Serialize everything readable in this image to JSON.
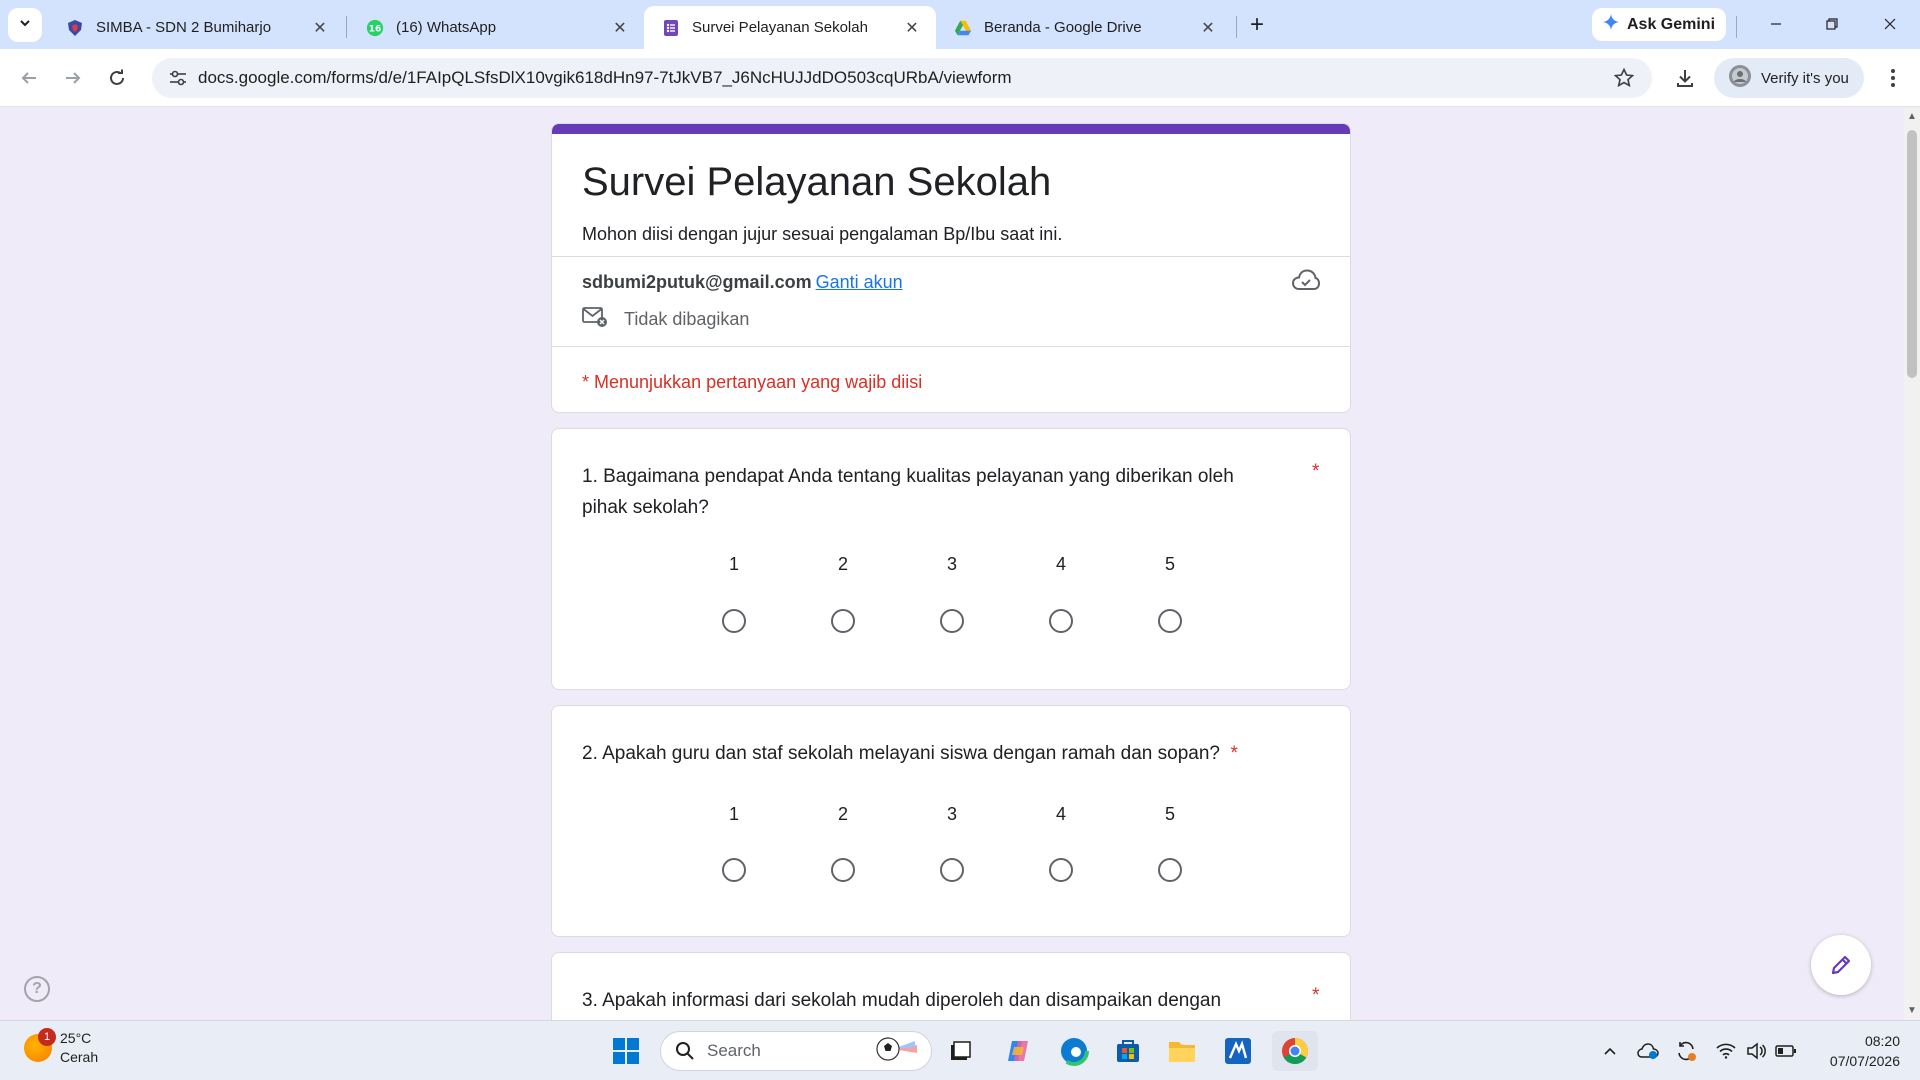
{
  "browser": {
    "tabs": [
      {
        "title": "SIMBA - SDN 2 Bumiharjo",
        "active": false
      },
      {
        "title": "(16) WhatsApp",
        "badge": "16",
        "active": false
      },
      {
        "title": "Survei Pelayanan Sekolah",
        "active": true
      },
      {
        "title": "Beranda - Google Drive",
        "active": false
      }
    ],
    "ask_gemini": "Ask Gemini",
    "url": "docs.google.com/forms/d/e/1FAIpQLSfsDlX10vgik618dHn97-7tJkVB7_J6NcHUJJdDO503cqURbA/viewform",
    "verify_label": "Verify it's you"
  },
  "form": {
    "title": "Survei Pelayanan Sekolah",
    "description": "Mohon diisi dengan jujur sesuai pengalaman Bp/Ibu saat ini.",
    "email": "sdbumi2putuk@gmail.com",
    "switch_account": "Ganti akun",
    "not_shared": "Tidak dibagikan",
    "required_note": "* Menunjukkan pertanyaan yang wajib diisi",
    "required_mark": "*",
    "questions": [
      {
        "text": "1. Bagaimana pendapat Anda tentang kualitas pelayanan yang diberikan oleh pihak sekolah?",
        "scale": [
          "1",
          "2",
          "3",
          "4",
          "5"
        ]
      },
      {
        "text": "2. Apakah guru dan staf sekolah melayani siswa dengan ramah dan sopan?",
        "scale": [
          "1",
          "2",
          "3",
          "4",
          "5"
        ]
      },
      {
        "text": "3. Apakah informasi dari sekolah mudah diperoleh dan disampaikan dengan"
      }
    ]
  },
  "taskbar": {
    "temperature": "25°C",
    "condition": "Cerah",
    "weather_badge": "1",
    "search_label": "Search",
    "time": "08:20",
    "date": "07/07/2026"
  },
  "colors": {
    "form_accent": "#673ab7",
    "required": "#d93025",
    "link": "#1a73e8",
    "page_bg": "#f0ebf8",
    "tabstrip_bg": "#d3e3fd"
  }
}
